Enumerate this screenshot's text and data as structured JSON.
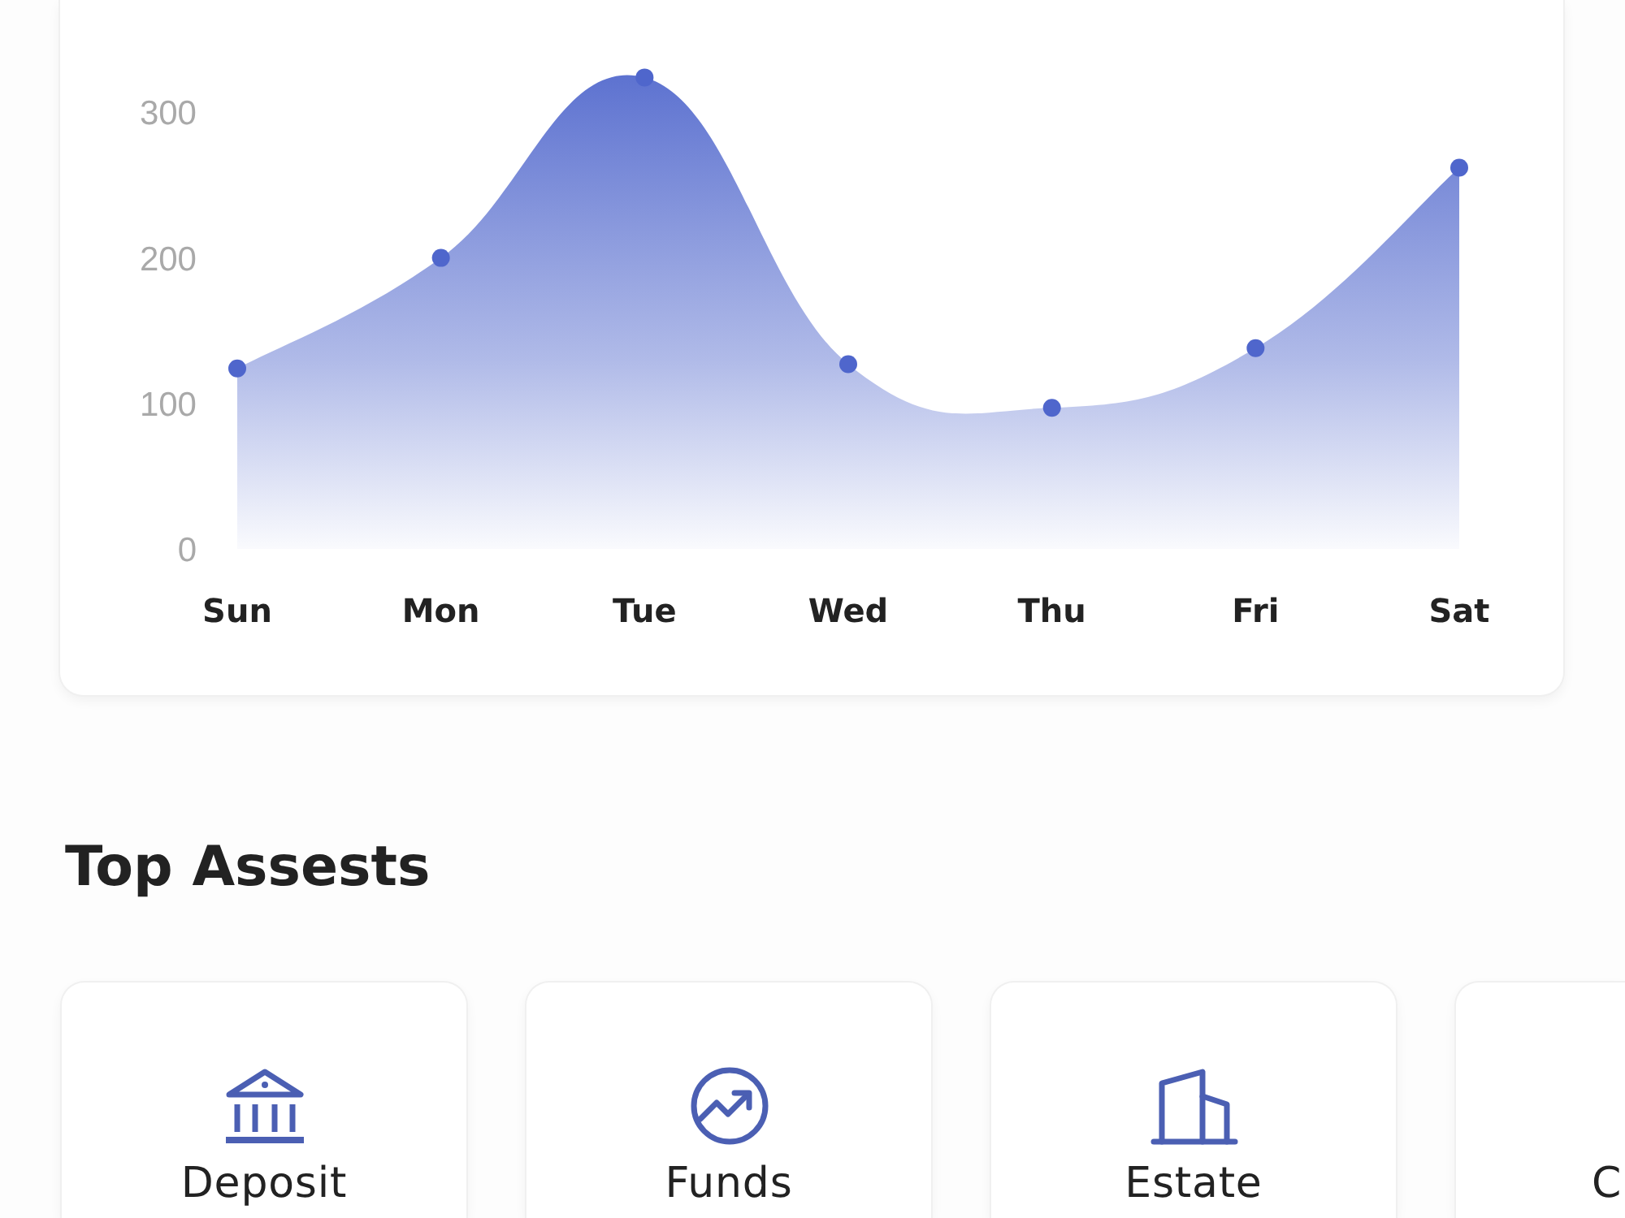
{
  "chart": {
    "chart_data": {
      "type": "area",
      "categories": [
        "Sun",
        "Mon",
        "Tue",
        "Wed",
        "Thu",
        "Fri",
        "Sat"
      ],
      "series": [
        {
          "color": "#4f66cc",
          "values": [
            124,
            200,
            324,
            127,
            97,
            138,
            262
          ]
        }
      ],
      "ylim": [
        0,
        375
      ],
      "yticks": [
        0,
        100,
        200,
        300
      ]
    }
  },
  "top_assets": {
    "title": "Top Assests",
    "cards": [
      {
        "kind": "bank",
        "label": "Deposit"
      },
      {
        "kind": "trend",
        "label": "Funds"
      },
      {
        "kind": "building",
        "label": "Estate"
      },
      {
        "label": "C"
      }
    ]
  }
}
